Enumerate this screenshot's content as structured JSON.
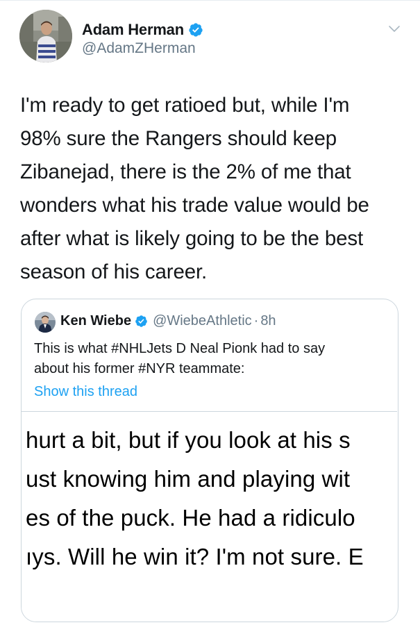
{
  "tweet": {
    "author": {
      "display_name": "Adam Herman",
      "handle": "@AdamZHerman",
      "verified": true
    },
    "text_lines": [
      "I'm ready to get ratioed but, while I'm",
      "98% sure the Rangers should keep",
      "Zibanejad, there is the 2% of me that",
      "wonders what his trade value would be",
      "after what is likely going to be the best",
      "season of his career."
    ],
    "menu_icon": "chevron-down-icon"
  },
  "quoted_tweet": {
    "author": {
      "display_name": "Ken Wiebe",
      "handle": "@WiebeAthletic",
      "verified": true
    },
    "separator": "·",
    "time": "8h",
    "text_lines": [
      "This is what #NHLJets D Neal Pionk had to say",
      "about his former #NYR teammate:"
    ],
    "show_thread_label": "Show this thread",
    "media_text_lines": [
      "hurt a bit, but if you look at his s",
      "ust knowing him and playing wit",
      "es of the puck. He had a ridiculo",
      "ıys. Will he win it? I'm not sure. E"
    ]
  },
  "colors": {
    "link": "#1da1f2",
    "verified": "#1da1f2",
    "secondary_text": "#657786",
    "border": "#ccd6dd"
  }
}
